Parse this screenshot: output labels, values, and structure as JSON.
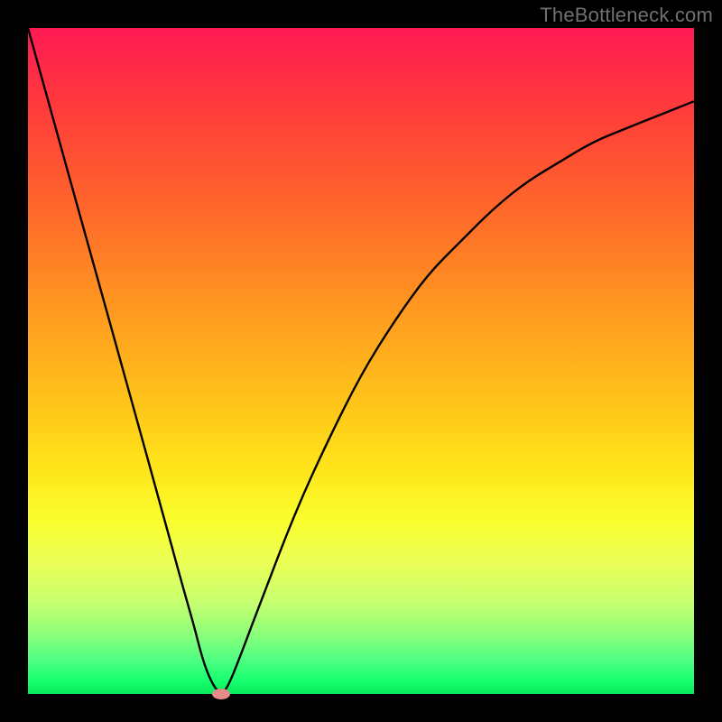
{
  "watermark": "TheBottleneck.com",
  "chart_data": {
    "type": "line",
    "title": "",
    "xlabel": "",
    "ylabel": "",
    "xlim": [
      0,
      100
    ],
    "ylim": [
      0,
      100
    ],
    "grid": false,
    "legend": false,
    "background": "gradient_red_to_green_vertical",
    "series": [
      {
        "name": "curve",
        "color": "#000000",
        "x": [
          0,
          5,
          10,
          15,
          20,
          23,
          25,
          26,
          27,
          28,
          29,
          30,
          32,
          35,
          40,
          45,
          50,
          55,
          60,
          65,
          70,
          75,
          80,
          85,
          90,
          95,
          100
        ],
        "y": [
          100,
          82,
          64,
          46,
          28,
          17,
          10,
          6,
          3,
          1,
          0,
          1,
          6,
          14,
          27,
          38,
          48,
          56,
          63,
          68,
          73,
          77,
          80,
          83,
          85,
          87,
          89
        ]
      }
    ],
    "marker": {
      "x": 29,
      "y": 0,
      "color": "#e68a8a"
    }
  },
  "colors": {
    "frame": "#000000",
    "curve": "#000000",
    "marker": "#e68a8a",
    "watermark": "#707070"
  }
}
